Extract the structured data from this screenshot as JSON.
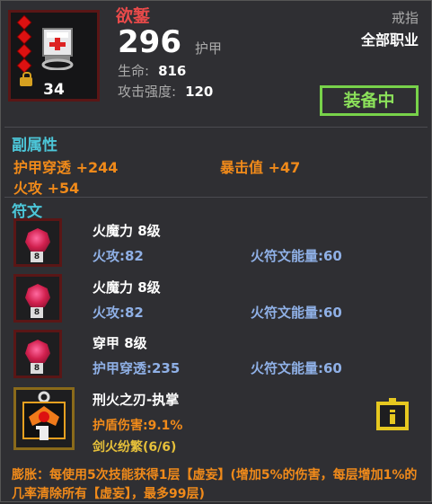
{
  "item": {
    "name": "欲錾",
    "level": "34",
    "main_value": "296",
    "main_label": "护甲",
    "stats": [
      {
        "label": "生命:",
        "value": "816"
      },
      {
        "label": "攻击强度:",
        "value": "120"
      }
    ],
    "slot": "戒指",
    "class": "全部职业",
    "equip_label": "装备中",
    "rarity_gems": 4
  },
  "sub_attrs": {
    "title": "副属性",
    "items": [
      {
        "label": "护甲穿透 +244"
      },
      {
        "label": "暴击值 +47"
      },
      {
        "label": "火攻 +54"
      }
    ]
  },
  "runes": {
    "title": "符文",
    "items": [
      {
        "name": "火魔力 8级",
        "stat1": "火攻:82",
        "stat2": "火符文能量:60",
        "badge": "8"
      },
      {
        "name": "火魔力 8级",
        "stat1": "火攻:82",
        "stat2": "火符文能量:60",
        "badge": "8"
      },
      {
        "name": "穿甲 8级",
        "stat1": "护甲穿透:235",
        "stat2": "火符文能量:60",
        "badge": "8"
      }
    ]
  },
  "weapon_skill": {
    "name": "刑火之刃-执掌",
    "stat1": "护盾伤害:9.1%",
    "stat2": "剑火纷繁(6/6)"
  },
  "passive": {
    "text": "膨胀：每使用5次技能获得1层【虚妄】(增加5%的伤害，每层增加1%的几率清除所有【虚妄】，最多99层)"
  },
  "colors": {
    "name_red": "#e84a4a",
    "section_cyan": "#4cc6d8",
    "attr_orange": "#f08a1a",
    "equip_green": "#78d24a",
    "rune_blue": "#8fb0e6"
  }
}
